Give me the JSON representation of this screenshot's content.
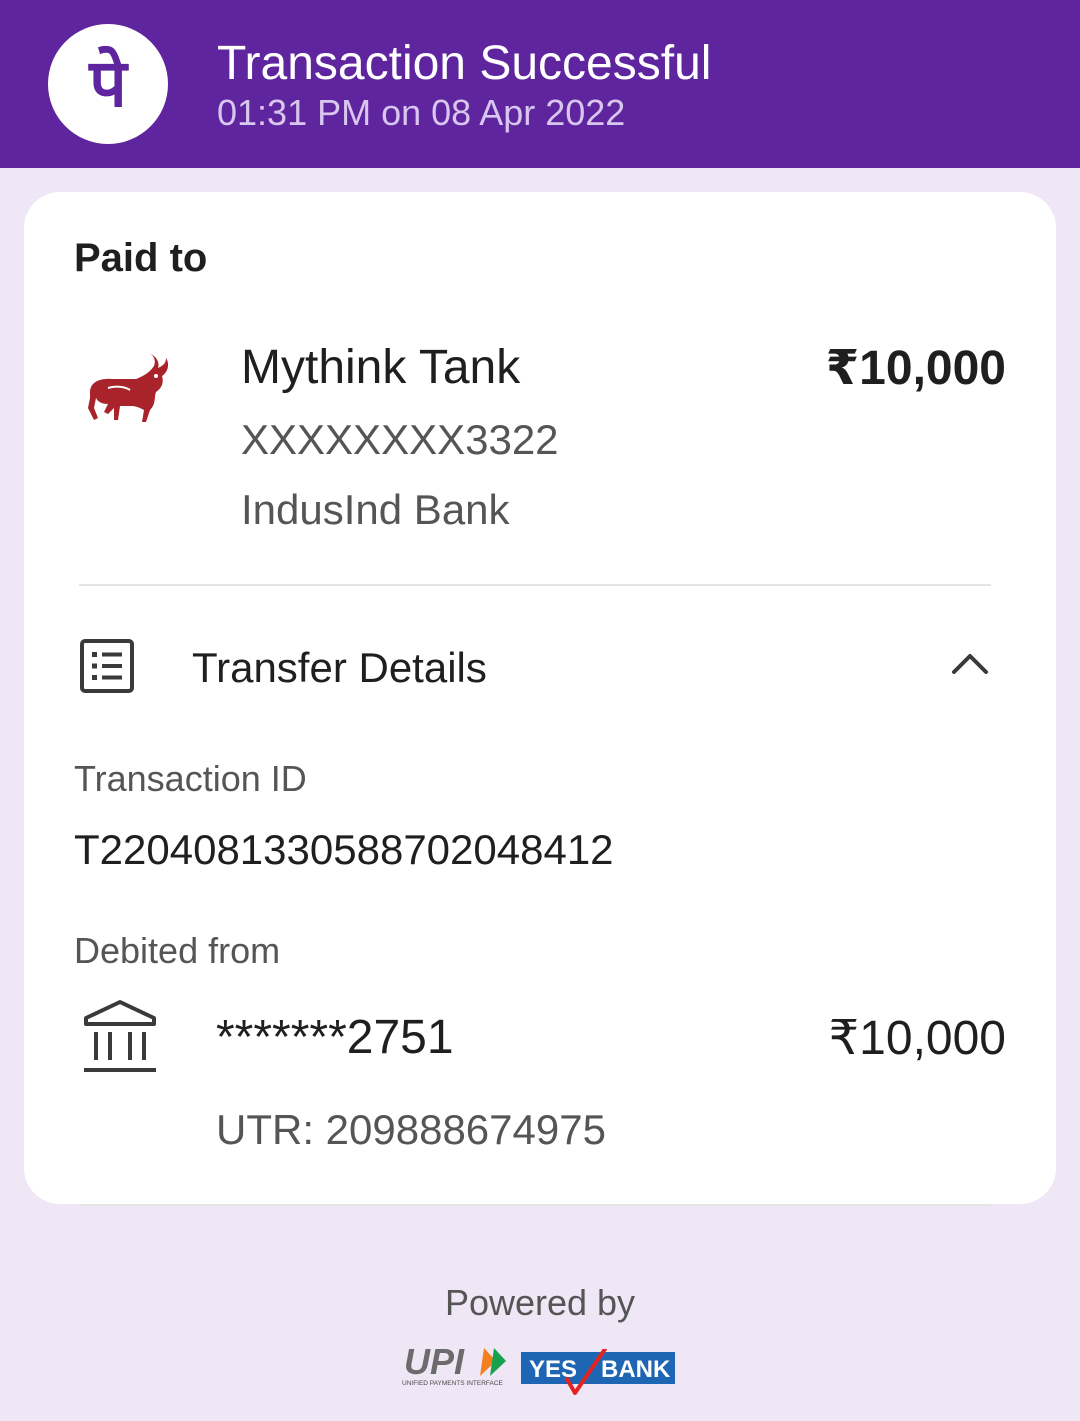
{
  "header": {
    "logo_glyph": "पे",
    "title": "Transaction Successful",
    "subtitle": "01:31 PM on 08 Apr 2022",
    "bg_color": "#5f259f"
  },
  "paid_to": {
    "heading": "Paid to",
    "payee_logo_icon": "indusind-bull-logo",
    "payee_name": "Mythink Tank",
    "account": "XXXXXXXX3322",
    "bank": "IndusInd Bank",
    "amount": "₹10,000"
  },
  "transfer_details": {
    "label": "Transfer Details",
    "icon": "receipt-list-icon",
    "toggle_icon": "chevron-up-icon",
    "transaction_id_label": "Transaction ID",
    "transaction_id": "T2204081330588702048412",
    "debited_from_label": "Debited from",
    "debited_account": "*******2751",
    "debited_amount": "₹10,000",
    "utr": "UTR: 209888674975"
  },
  "footer": {
    "powered_by": "Powered by",
    "upi_logo_text": "UPI",
    "upi_tagline": "UNIFIED PAYMENTS INTERFACE",
    "bank_logo_text_1": "YES",
    "bank_logo_text_2": "BANK"
  }
}
